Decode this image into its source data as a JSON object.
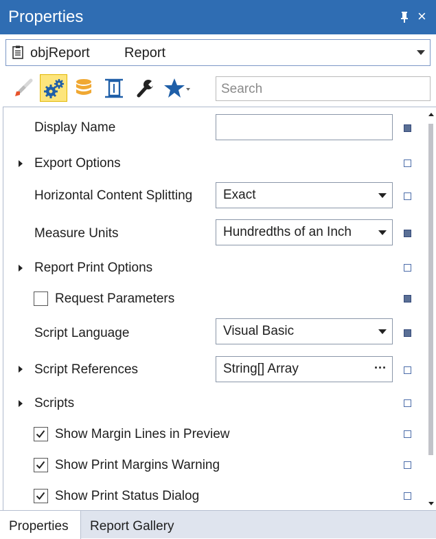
{
  "window": {
    "title": "Properties",
    "pin_icon": "pin-icon",
    "close_label": "×"
  },
  "object_selector": {
    "name": "objReport",
    "type": "Report"
  },
  "toolbar": {
    "buttons": [
      "paintbrush-icon",
      "gears-icon",
      "database-icon",
      "layout-icon",
      "wrench-icon",
      "star-icon"
    ],
    "active_button": "gears-icon",
    "search_placeholder": "Search"
  },
  "properties": [
    {
      "label": "Display Name",
      "kind": "text",
      "value": "",
      "marker": "set"
    },
    {
      "label": "Export Options",
      "kind": "group",
      "marker": "unset"
    },
    {
      "label": "Horizontal Content Splitting",
      "kind": "dropdown",
      "value": "Exact",
      "marker": "unset"
    },
    {
      "label": "Measure Units",
      "kind": "dropdown",
      "value": "Hundredths of an Inch",
      "marker": "set"
    },
    {
      "label": "Report Print Options",
      "kind": "group",
      "marker": "unset"
    },
    {
      "label": "Request Parameters",
      "kind": "checkbox",
      "checked": false,
      "marker": "set"
    },
    {
      "label": "Script Language",
      "kind": "dropdown",
      "value": "Visual Basic",
      "marker": "set"
    },
    {
      "label": "Script References",
      "kind": "ellipsis",
      "value": "String[] Array",
      "ellipsis": "···",
      "marker": "unset"
    },
    {
      "label": "Scripts",
      "kind": "group",
      "marker": "unset"
    },
    {
      "label": "Show Margin Lines in Preview",
      "kind": "checkbox",
      "checked": true,
      "marker": "unset"
    },
    {
      "label": "Show Print Margins Warning",
      "kind": "checkbox",
      "checked": true,
      "marker": "unset"
    },
    {
      "label": "Show Print Status Dialog",
      "kind": "checkbox",
      "checked": true,
      "marker": "unset"
    }
  ],
  "tabs": [
    {
      "label": "Properties",
      "active": true
    },
    {
      "label": "Report Gallery",
      "active": false
    }
  ],
  "colors": {
    "titlebar": "#2f6db3",
    "active_tool": "#fde57c",
    "marker_set": "#5a6f95",
    "marker_unset": "#4a6ba8"
  }
}
